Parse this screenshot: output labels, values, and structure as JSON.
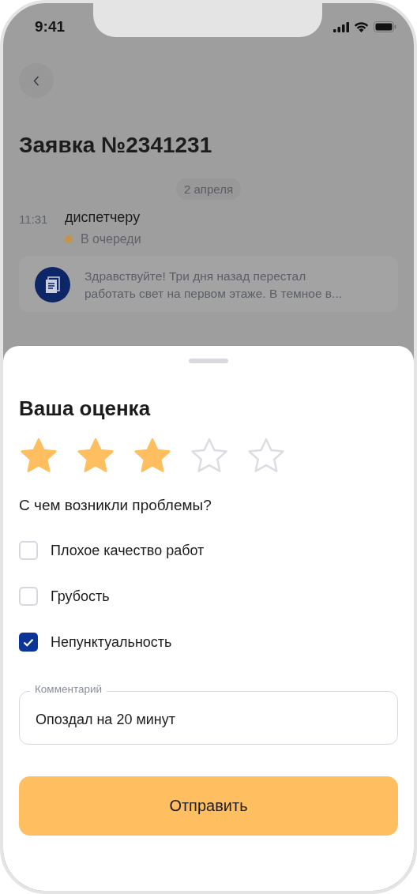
{
  "status_bar": {
    "time": "9:41"
  },
  "request": {
    "title": "Заявка №2341231",
    "date": "2 апреля",
    "time": "11:31",
    "recipient": "диспетчеру",
    "status": {
      "label": "В очереди",
      "color": "#c4944a"
    },
    "message": "Здравствуйте! Три дня назад перестал работать свет на первом этаже. В темное в..."
  },
  "rating_sheet": {
    "title": "Ваша оценка",
    "stars": 3,
    "question": "С чем возникли проблемы?",
    "options": [
      {
        "label": "Плохое качество работ",
        "checked": false
      },
      {
        "label": "Грубость",
        "checked": false
      },
      {
        "label": "Непунктуальность",
        "checked": true
      }
    ],
    "comment": {
      "label": "Комментарий",
      "value": "Опоздал на 20 минут"
    },
    "submit": "Отправить"
  }
}
